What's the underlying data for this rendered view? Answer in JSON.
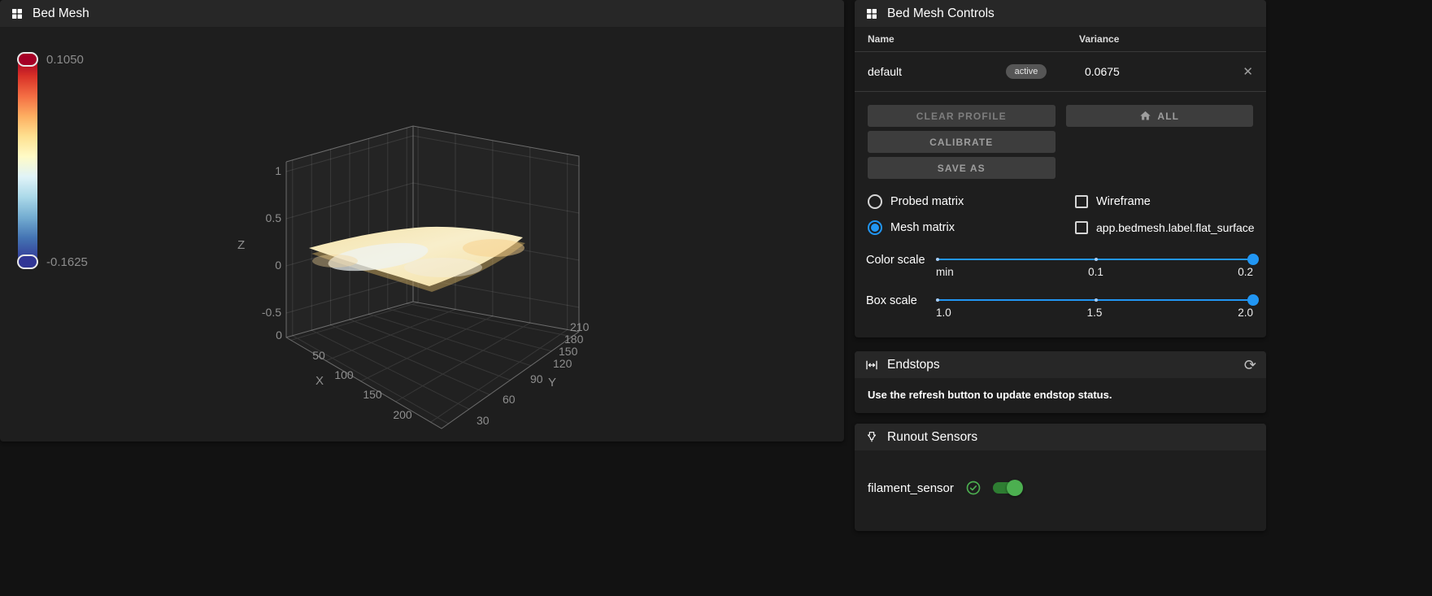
{
  "bed_mesh": {
    "title": "Bed Mesh",
    "colorbar": {
      "max": "0.1050",
      "min": "-0.1625"
    },
    "axes": {
      "x_label": "X",
      "y_label": "Y",
      "z_label": "Z",
      "x_ticks": [
        "0",
        "50",
        "100",
        "150",
        "200"
      ],
      "y_ticks": [
        "30",
        "60",
        "90",
        "120",
        "150",
        "180",
        "210"
      ],
      "z_ticks": [
        "1",
        "0.5",
        "0",
        "-0.5"
      ]
    }
  },
  "controls": {
    "title": "Bed Mesh Controls",
    "table": {
      "name_header": "Name",
      "variance_header": "Variance",
      "rows": [
        {
          "name": "default",
          "badge": "active",
          "variance": "0.0675"
        }
      ]
    },
    "buttons": {
      "clear_profile": "CLEAR PROFILE",
      "all": "ALL",
      "calibrate": "CALIBRATE",
      "save_as": "SAVE AS"
    },
    "radios": [
      {
        "label": "Probed matrix",
        "selected": false
      },
      {
        "label": "Mesh matrix",
        "selected": true
      }
    ],
    "checkboxes": [
      {
        "label": "Wireframe",
        "checked": false
      },
      {
        "label": "app.bedmesh.label.flat_surface",
        "checked": false
      }
    ],
    "color_scale": {
      "label": "Color scale",
      "ticks": [
        "min",
        "0.1",
        "0.2"
      ]
    },
    "box_scale": {
      "label": "Box scale",
      "ticks": [
        "1.0",
        "1.5",
        "2.0"
      ]
    }
  },
  "endstops": {
    "title": "Endstops",
    "message": "Use the refresh button to update endstop status."
  },
  "runout": {
    "title": "Runout Sensors",
    "sensors": [
      {
        "name": "filament_sensor",
        "enabled": true
      }
    ]
  },
  "theme": {
    "accent": "#2196f3",
    "green": "#4caf50",
    "card": "#1e1e1e",
    "header": "#272727",
    "background": "#121212"
  }
}
